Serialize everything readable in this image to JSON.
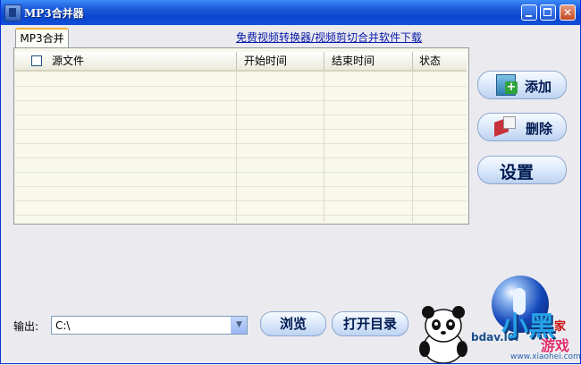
{
  "window": {
    "title": "MP3合并器"
  },
  "tab": {
    "label": "MP3合并"
  },
  "promo_link": "免费视频转换器/视频剪切合并软件下载",
  "table": {
    "columns": [
      "源文件",
      "开始时间",
      "结束时间",
      "状态"
    ],
    "rows": []
  },
  "side_buttons": {
    "add": "添加",
    "delete": "删除",
    "settings": "设置"
  },
  "output": {
    "label": "输出:",
    "value": "C:\\"
  },
  "bottom_buttons": {
    "browse": "浏览",
    "open_dir": "打开目录"
  },
  "watermark": {
    "brand": "小黑",
    "home": "家",
    "game": "游戏",
    "domain": "www.xiaohei.com",
    "partial": "bdav.l0l"
  },
  "colors": {
    "titlebar": "#0A46D0",
    "window_bg": "#EAEAEF",
    "list_bg": "#F8F7EC",
    "link": "#0A1AA8"
  }
}
